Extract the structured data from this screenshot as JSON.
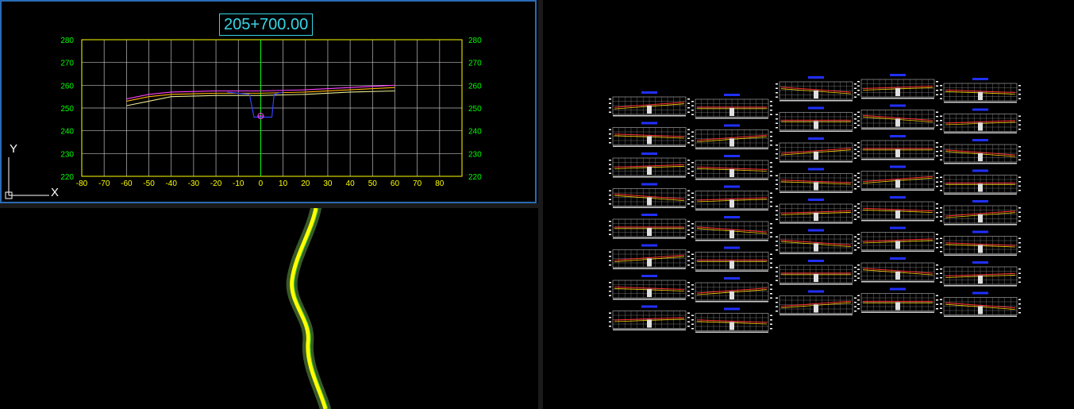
{
  "section_view": {
    "station_label": "205+700.00",
    "y_ticks": [
      "280",
      "270",
      "260",
      "250",
      "240",
      "230",
      "220"
    ],
    "x_ticks": [
      "-80",
      "-70",
      "-60",
      "-50",
      "-40",
      "-30",
      "-20",
      "-10",
      "0",
      "10",
      "20",
      "30",
      "40",
      "50",
      "60",
      "70",
      "80"
    ],
    "offset_range": [
      -80,
      90
    ],
    "elevation_range": [
      220,
      280
    ],
    "surfaces": [
      {
        "color": "#ff40ff",
        "points": [
          [
            -60,
            254
          ],
          [
            -50,
            256
          ],
          [
            -40,
            257
          ],
          [
            -20,
            257.5
          ],
          [
            0,
            257.5
          ],
          [
            20,
            258
          ],
          [
            40,
            259
          ],
          [
            60,
            260
          ]
        ]
      },
      {
        "color": "#ffb000",
        "points": [
          [
            -60,
            253
          ],
          [
            -50,
            255
          ],
          [
            -40,
            256
          ],
          [
            -20,
            256.5
          ],
          [
            0,
            256.5
          ],
          [
            20,
            257
          ],
          [
            40,
            258
          ],
          [
            60,
            259
          ]
        ]
      },
      {
        "color": "#e8e890",
        "points": [
          [
            -60,
            251
          ],
          [
            -50,
            253
          ],
          [
            -40,
            255
          ],
          [
            -20,
            255.5
          ],
          [
            0,
            255.5
          ],
          [
            20,
            256
          ],
          [
            40,
            257
          ],
          [
            60,
            257.5
          ]
        ]
      }
    ],
    "channel": {
      "color": "#3040ff",
      "points": [
        [
          -15,
          257
        ],
        [
          -5,
          256
        ],
        [
          -3,
          246
        ],
        [
          5,
          246
        ],
        [
          6,
          256
        ],
        [
          10,
          257
        ]
      ]
    },
    "point_marker": {
      "offset": 0,
      "elevation": 246.5,
      "color": "#ff40ff"
    },
    "ucs": {
      "x_label": "X",
      "y_label": "Y"
    }
  },
  "sheet_view": {
    "columns": 5,
    "rows": 8
  }
}
